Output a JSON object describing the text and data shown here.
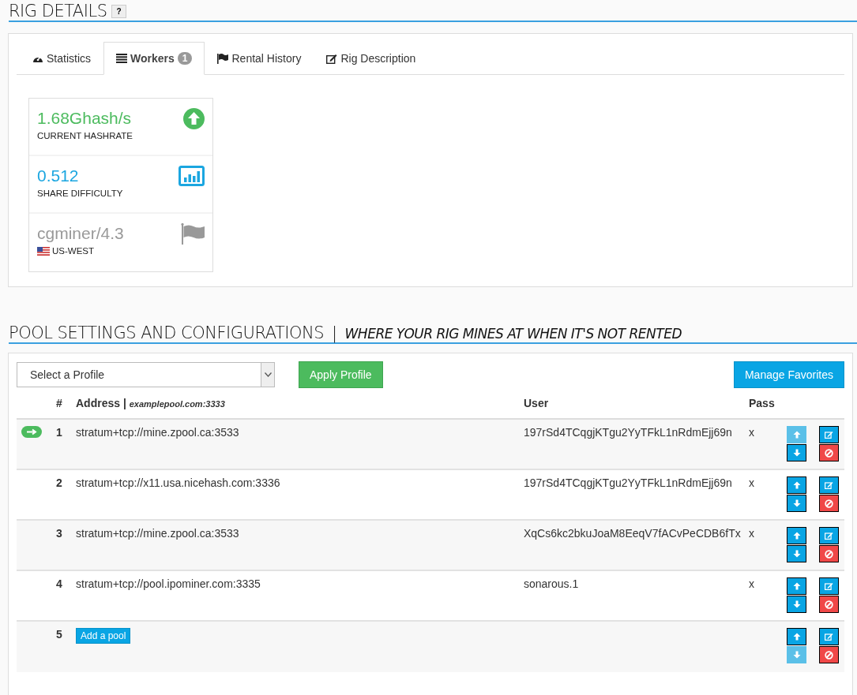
{
  "rig_details": {
    "title": "RIG DETAILS",
    "help": "?",
    "tabs": [
      {
        "label": "Statistics",
        "selected": false
      },
      {
        "label": "Workers",
        "badge": "1",
        "selected": true
      },
      {
        "label": "Rental History",
        "selected": false
      },
      {
        "label": "Rig Description",
        "selected": false
      }
    ],
    "stats": [
      {
        "kind": "hashrate",
        "value": "1.68Ghash/s",
        "label": "CURRENT HASHRATE"
      },
      {
        "kind": "difficulty",
        "value": "0.512",
        "label": "SHARE DIFFICULTY"
      },
      {
        "kind": "software",
        "value": "cgminer/4.3",
        "label": "US-WEST"
      }
    ]
  },
  "pool_settings": {
    "title": "POOL SETTINGS AND CONFIGURATIONS",
    "separator": "|",
    "subtitle": "WHERE YOUR RIG MINES AT WHEN IT'S NOT RENTED",
    "profile_select": {
      "value": "Select a Profile"
    },
    "apply_button": "Apply Profile",
    "favorites_button": "Manage Favorites",
    "columns": {
      "number": "#",
      "address": "Address |",
      "address_example": "examplepool.com:3333",
      "user": "User",
      "pass": "Pass"
    },
    "rows": [
      {
        "kind": "pool",
        "number": "1",
        "address": "stratum+tcp://mine.zpool.ca:3533",
        "user": "197rSd4TCqgjKTgu2YyTFkL1nRdmEjj69n",
        "pass": "x",
        "active": true,
        "up_disabled": true,
        "down_disabled": false
      },
      {
        "kind": "pool",
        "number": "2",
        "address": "stratum+tcp://x11.usa.nicehash.com:3336",
        "user": "197rSd4TCqgjKTgu2YyTFkL1nRdmEjj69n",
        "pass": "x",
        "active": false,
        "up_disabled": false,
        "down_disabled": false
      },
      {
        "kind": "pool",
        "number": "3",
        "address": "stratum+tcp://mine.zpool.ca:3533",
        "user": "XqCs6kc2bkuJoaM8EeqV7fACvPeCDB6fTx",
        "pass": "x",
        "active": false,
        "up_disabled": false,
        "down_disabled": false
      },
      {
        "kind": "pool",
        "number": "4",
        "address": "stratum+tcp://pool.ipominer.com:3335",
        "user": "sonarous.1",
        "pass": "x",
        "active": false,
        "up_disabled": false,
        "down_disabled": false
      },
      {
        "kind": "add",
        "number": "5",
        "button": "Add a pool",
        "active": false,
        "up_disabled": false,
        "down_disabled": true
      }
    ]
  }
}
